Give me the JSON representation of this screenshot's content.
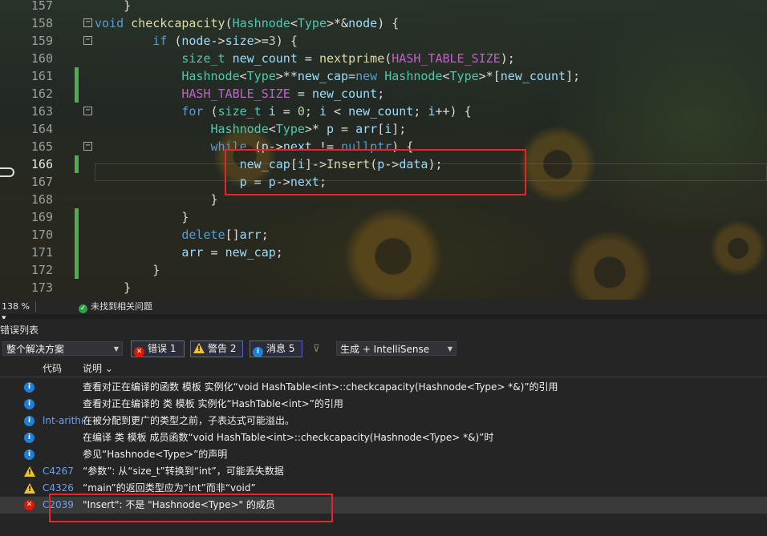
{
  "editor": {
    "lines": [
      {
        "n": "157",
        "tokens": [
          [
            "pl",
            "    }"
          ]
        ]
      },
      {
        "n": "158",
        "tokens": [
          [
            "kw",
            "void "
          ],
          [
            "fn",
            "checkcapacity"
          ],
          [
            "pl",
            "("
          ],
          [
            "ty",
            "Hashnode"
          ],
          [
            "pl",
            "<"
          ],
          [
            "ty",
            "Type"
          ],
          [
            "pl",
            ">*&"
          ],
          [
            "vr",
            "node"
          ],
          [
            "pl",
            ") {"
          ]
        ]
      },
      {
        "n": "159",
        "tokens": [
          [
            "pl",
            "        "
          ],
          [
            "kw",
            "if "
          ],
          [
            "pl",
            "("
          ],
          [
            "vr",
            "node"
          ],
          [
            "pl",
            "->"
          ],
          [
            "vr",
            "size"
          ],
          [
            "pl",
            ">="
          ],
          [
            "nm",
            "3"
          ],
          [
            "pl",
            ") {"
          ]
        ]
      },
      {
        "n": "160",
        "tokens": [
          [
            "pl",
            "            "
          ],
          [
            "ty",
            "size_t "
          ],
          [
            "vr",
            "new_count"
          ],
          [
            "pl",
            " = "
          ],
          [
            "fn",
            "nextprime"
          ],
          [
            "pl",
            "("
          ],
          [
            "mc",
            "HASH_TABLE_SIZE"
          ],
          [
            "pl",
            ");"
          ]
        ]
      },
      {
        "n": "161",
        "tokens": [
          [
            "pl",
            "            "
          ],
          [
            "ty",
            "Hashnode"
          ],
          [
            "pl",
            "<"
          ],
          [
            "ty",
            "Type"
          ],
          [
            "pl",
            ">**"
          ],
          [
            "vr",
            "new_cap"
          ],
          [
            "pl",
            "="
          ],
          [
            "kw",
            "new "
          ],
          [
            "ty",
            "Hashnode"
          ],
          [
            "pl",
            "<"
          ],
          [
            "ty",
            "Type"
          ],
          [
            "pl",
            ">*["
          ],
          [
            "vr",
            "new_count"
          ],
          [
            "pl",
            "];"
          ]
        ]
      },
      {
        "n": "162",
        "tokens": [
          [
            "pl",
            "            "
          ],
          [
            "mc",
            "HASH_TABLE_SIZE"
          ],
          [
            "pl",
            " = "
          ],
          [
            "vr",
            "new_count"
          ],
          [
            "pl",
            ";"
          ]
        ]
      },
      {
        "n": "163",
        "tokens": [
          [
            "pl",
            "            "
          ],
          [
            "kw",
            "for "
          ],
          [
            "pl",
            "("
          ],
          [
            "ty",
            "size_t "
          ],
          [
            "vr",
            "i"
          ],
          [
            "pl",
            " = "
          ],
          [
            "nm",
            "0"
          ],
          [
            "pl",
            "; "
          ],
          [
            "vr",
            "i"
          ],
          [
            "pl",
            " < "
          ],
          [
            "vr",
            "new_count"
          ],
          [
            "pl",
            "; "
          ],
          [
            "vr",
            "i"
          ],
          [
            "pl",
            "++) {"
          ]
        ]
      },
      {
        "n": "164",
        "tokens": [
          [
            "pl",
            "                "
          ],
          [
            "ty",
            "Hashnode"
          ],
          [
            "pl",
            "<"
          ],
          [
            "ty",
            "Type"
          ],
          [
            "pl",
            ">* "
          ],
          [
            "vr",
            "p"
          ],
          [
            "pl",
            " = "
          ],
          [
            "vr",
            "arr"
          ],
          [
            "pl",
            "["
          ],
          [
            "vr",
            "i"
          ],
          [
            "pl",
            "];"
          ]
        ]
      },
      {
        "n": "165",
        "tokens": [
          [
            "pl",
            "                "
          ],
          [
            "kw",
            "while "
          ],
          [
            "pl",
            "("
          ],
          [
            "vr",
            "p"
          ],
          [
            "pl",
            "->"
          ],
          [
            "vr",
            "next"
          ],
          [
            "pl",
            " != "
          ],
          [
            "kw",
            "nullptr"
          ],
          [
            "pl",
            ") {"
          ]
        ]
      },
      {
        "n": "166",
        "tokens": [
          [
            "pl",
            "                    "
          ],
          [
            "vr",
            "new_cap"
          ],
          [
            "pl",
            "["
          ],
          [
            "vr",
            "i"
          ],
          [
            "pl",
            "]->"
          ],
          [
            "fn",
            "Insert"
          ],
          [
            "pl",
            "("
          ],
          [
            "vr",
            "p"
          ],
          [
            "pl",
            "->"
          ],
          [
            "vr",
            "data"
          ],
          [
            "pl",
            ");"
          ]
        ]
      },
      {
        "n": "167",
        "tokens": [
          [
            "pl",
            "                    "
          ],
          [
            "vr",
            "p"
          ],
          [
            "pl",
            " = "
          ],
          [
            "vr",
            "p"
          ],
          [
            "pl",
            "->"
          ],
          [
            "vr",
            "next"
          ],
          [
            "pl",
            ";"
          ]
        ]
      },
      {
        "n": "168",
        "tokens": [
          [
            "pl",
            "                }"
          ]
        ]
      },
      {
        "n": "169",
        "tokens": [
          [
            "pl",
            "            }"
          ]
        ]
      },
      {
        "n": "170",
        "tokens": [
          [
            "pl",
            "            "
          ],
          [
            "kw",
            "delete"
          ],
          [
            "pl",
            "[]"
          ],
          [
            "vr",
            "arr"
          ],
          [
            "pl",
            ";"
          ]
        ]
      },
      {
        "n": "171",
        "tokens": [
          [
            "pl",
            "            "
          ],
          [
            "vr",
            "arr"
          ],
          [
            "pl",
            " = "
          ],
          [
            "vr",
            "new_cap"
          ],
          [
            "pl",
            ";"
          ]
        ]
      },
      {
        "n": "172",
        "tokens": [
          [
            "pl",
            "        }"
          ]
        ]
      },
      {
        "n": "173",
        "tokens": [
          [
            "pl",
            "    }"
          ]
        ]
      }
    ]
  },
  "status": {
    "zoom": "138 %",
    "issues": "未找到相关问题"
  },
  "errorlist": {
    "title": "错误列表",
    "scope": "整个解决方案",
    "errors_label": "错误 1",
    "warnings_label": "警告 2",
    "messages_label": "消息 5",
    "build_mode": "生成 + IntelliSense",
    "col_code": "代码",
    "col_desc": "说明",
    "rows": [
      {
        "type": "info",
        "code": "",
        "desc": "查看对正在编译的函数 模板 实例化“void HashTable<int>::checkcapacity(Hashnode<Type> *&)”的引用"
      },
      {
        "type": "info",
        "code": "",
        "desc": "查看对正在编译的 类 模板 实例化“HashTable<int>”的引用"
      },
      {
        "type": "info",
        "code": "lnt-arithmetic-overflow",
        "desc": "在被分配到更广的类型之前，子表达式可能溢出。"
      },
      {
        "type": "info",
        "code": "",
        "desc": "在编译 类 模板 成员函数“void HashTable<int>::checkcapacity(Hashnode<Type> *&)”时"
      },
      {
        "type": "info",
        "code": "",
        "desc": "参见“Hashnode<Type>”的声明"
      },
      {
        "type": "warn",
        "code": "C4267",
        "desc": "“参数”: 从“size_t”转换到“int”，可能丢失数据"
      },
      {
        "type": "warn",
        "code": "C4326",
        "desc": "“main”的返回类型应为“int”而非“void”"
      },
      {
        "type": "err",
        "code": "C2039",
        "desc": "\"Insert\": 不是 \"Hashnode<Type>\" 的成员"
      }
    ]
  },
  "colors": {
    "accent": "#5b5bd6",
    "error": "#e51400",
    "warning": "#f2c12e",
    "info": "#1e7fd8",
    "highlight": "#e8242c"
  }
}
